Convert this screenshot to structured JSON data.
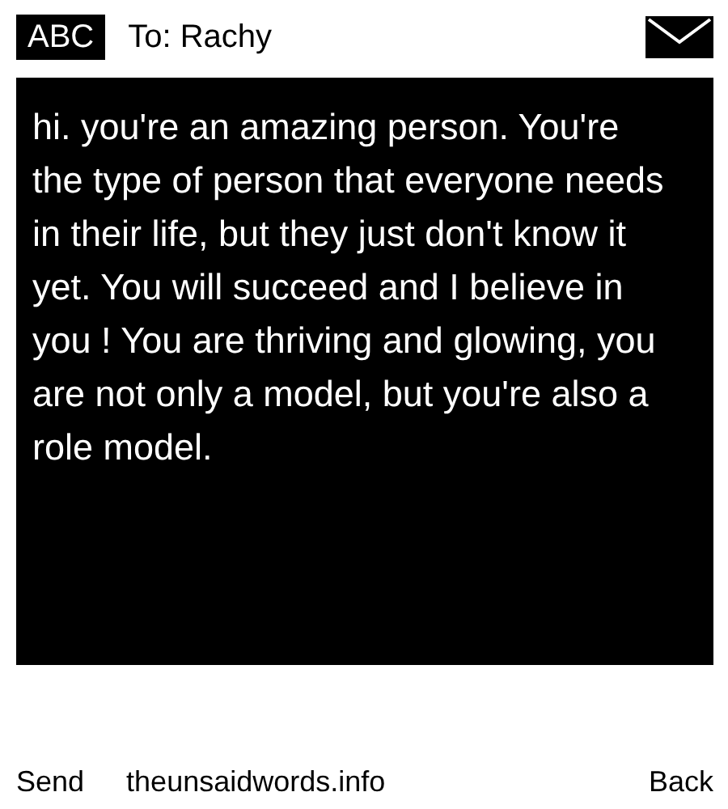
{
  "header": {
    "mode": "ABC",
    "recipient": "To: Rachy"
  },
  "message": "hi. you're an amazing person. You're the type of person that everyone needs in their life, but they just don't know it yet. You will succeed and I believe in you ! You are thriving and glowing, you are not only a model, but you're also a role model.",
  "footer": {
    "left": "Send",
    "center": "theunsaidwords.info",
    "right": "Back"
  }
}
